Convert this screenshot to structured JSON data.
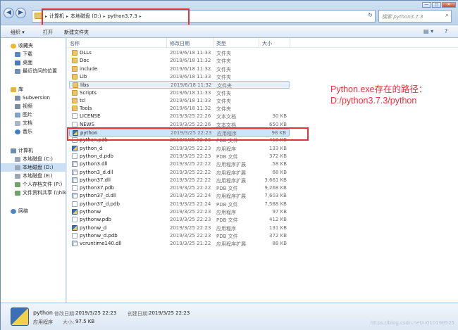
{
  "window": {
    "controls": [
      "—",
      "□",
      "✕"
    ]
  },
  "address": {
    "crumbs": [
      "计算机",
      "本地磁盘 (D:)",
      "python3.7.3"
    ],
    "separator": "▸",
    "refresh_icon": "↻"
  },
  "search": {
    "placeholder": "搜索 python3.7.3",
    "icon": "⌕"
  },
  "toolbar": {
    "organize": "组织 ▾",
    "open": "打开",
    "new_folder": "新建文件夹",
    "view_icon": "▤ ▾",
    "help_icon": "?"
  },
  "sidebar": {
    "items": [
      {
        "label": "收藏夹",
        "icon": "star-icon",
        "color": "#f2b632"
      },
      {
        "label": "下载",
        "icon": "download-folder-icon",
        "color": "#5b86c2"
      },
      {
        "label": "桌面",
        "icon": "desktop-icon",
        "color": "#4a7ab8"
      },
      {
        "label": "最近访问的位置",
        "icon": "recent-places-icon",
        "color": "#6e8fb6"
      },
      {
        "label": "库",
        "icon": "library-icon",
        "color": "#e3b448"
      },
      {
        "label": "Subversion",
        "icon": "subversion-icon",
        "color": "#7d8fa6"
      },
      {
        "label": "视频",
        "icon": "video-icon",
        "color": "#7b8da4"
      },
      {
        "label": "图片",
        "icon": "pictures-icon",
        "color": "#7fa3c8"
      },
      {
        "label": "文档",
        "icon": "documents-icon",
        "color": "#a8b6c8"
      },
      {
        "label": "音乐",
        "icon": "music-icon",
        "color": "#3f7fc4"
      },
      {
        "label": "计算机",
        "icon": "computer-icon",
        "color": "#6d8cb1"
      },
      {
        "label": "本地磁盘 (C:)",
        "icon": "drive-icon",
        "color": "#9aa7b8"
      },
      {
        "label": "本地磁盘 (D:)",
        "icon": "drive-icon",
        "color": "#9aa7b8"
      },
      {
        "label": "本地磁盘 (E:)",
        "icon": "drive-icon",
        "color": "#9aa7b8"
      },
      {
        "label": "个人存档文件 (P:)",
        "icon": "network-drive-icon",
        "color": "#6fa36a"
      },
      {
        "label": "文件资料共享 (\\\\hik",
        "icon": "network-drive-icon",
        "color": "#6fa36a"
      },
      {
        "label": "网络",
        "icon": "network-icon",
        "color": "#4f86c6"
      }
    ]
  },
  "columns": [
    "名称",
    "修改日期",
    "类型",
    "大小"
  ],
  "files": [
    {
      "name": "DLLs",
      "date": "2019/6/18 11:33",
      "type": "文件夹",
      "size": "",
      "icon": "folder"
    },
    {
      "name": "Doc",
      "date": "2019/6/18 11:32",
      "type": "文件夹",
      "size": "",
      "icon": "folder"
    },
    {
      "name": "include",
      "date": "2019/6/18 11:32",
      "type": "文件夹",
      "size": "",
      "icon": "folder"
    },
    {
      "name": "Lib",
      "date": "2019/6/18 11:33",
      "type": "文件夹",
      "size": "",
      "icon": "folder"
    },
    {
      "name": "libs",
      "date": "2019/6/18 11:32",
      "type": "文件夹",
      "size": "",
      "icon": "folder"
    },
    {
      "name": "Scripts",
      "date": "2019/6/18 11:33",
      "type": "文件夹",
      "size": "",
      "icon": "folder"
    },
    {
      "name": "tcl",
      "date": "2019/6/18 11:33",
      "type": "文件夹",
      "size": "",
      "icon": "folder"
    },
    {
      "name": "Tools",
      "date": "2019/6/18 11:32",
      "type": "文件夹",
      "size": "",
      "icon": "folder"
    },
    {
      "name": "LICENSE",
      "date": "2019/3/25 22:26",
      "type": "文本文档",
      "size": "30 KB",
      "icon": "file"
    },
    {
      "name": "NEWS",
      "date": "2019/3/25 22:26",
      "type": "文本文档",
      "size": "650 KB",
      "icon": "file"
    },
    {
      "name": "python",
      "date": "2019/3/25 22:23",
      "type": "应用程序",
      "size": "98 KB",
      "icon": "app"
    },
    {
      "name": "python.pdb",
      "date": "2019/3/25 22:23",
      "type": "PDB 文件",
      "size": "412 KB",
      "icon": "file"
    },
    {
      "name": "python_d",
      "date": "2019/3/25 22:23",
      "type": "应用程序",
      "size": "133 KB",
      "icon": "app"
    },
    {
      "name": "python_d.pdb",
      "date": "2019/3/25 22:23",
      "type": "PDB 文件",
      "size": "372 KB",
      "icon": "file"
    },
    {
      "name": "python3.dll",
      "date": "2019/3/25 22:22",
      "type": "应用程序扩展",
      "size": "58 KB",
      "icon": "dll"
    },
    {
      "name": "python3_d.dll",
      "date": "2019/3/25 22:22",
      "type": "应用程序扩展",
      "size": "68 KB",
      "icon": "dll"
    },
    {
      "name": "python37.dll",
      "date": "2019/3/25 22:22",
      "type": "应用程序扩展",
      "size": "3,661 KB",
      "icon": "dll"
    },
    {
      "name": "python37.pdb",
      "date": "2019/3/25 22:22",
      "type": "PDB 文件",
      "size": "9,268 KB",
      "icon": "file"
    },
    {
      "name": "python37_d.dll",
      "date": "2019/3/25 22:24",
      "type": "应用程序扩展",
      "size": "7,603 KB",
      "icon": "dll"
    },
    {
      "name": "python37_d.pdb",
      "date": "2019/3/25 22:24",
      "type": "PDB 文件",
      "size": "7,588 KB",
      "icon": "file"
    },
    {
      "name": "pythonw",
      "date": "2019/3/25 22:23",
      "type": "应用程序",
      "size": "97 KB",
      "icon": "app"
    },
    {
      "name": "pythonw.pdb",
      "date": "2019/3/25 22:23",
      "type": "PDB 文件",
      "size": "412 KB",
      "icon": "file"
    },
    {
      "name": "pythonw_d",
      "date": "2019/3/25 22:23",
      "type": "应用程序",
      "size": "131 KB",
      "icon": "app"
    },
    {
      "name": "pythonw_d.pdb",
      "date": "2019/3/25 22:23",
      "type": "PDB 文件",
      "size": "372 KB",
      "icon": "file"
    },
    {
      "name": "vcruntime140.dll",
      "date": "2019/3/25 21:22",
      "type": "应用程序扩展",
      "size": "88 KB",
      "icon": "dll"
    }
  ],
  "selected_file": "python",
  "annotation": {
    "line1": "Python.exe存在的路径：",
    "line2": "D:/python3.7.3/python",
    "color": "#e0343b"
  },
  "details": {
    "name": "python",
    "type": "应用程序",
    "modified_label": "修改日期:",
    "modified_value": "2019/3/25 22:23",
    "created_label": "创建日期:",
    "created_value": "2019/3/25 22:23",
    "size_label": "大小:",
    "size_value": "97.5 KB",
    "watermark": "https://blog.csdn.net/u010198525"
  }
}
